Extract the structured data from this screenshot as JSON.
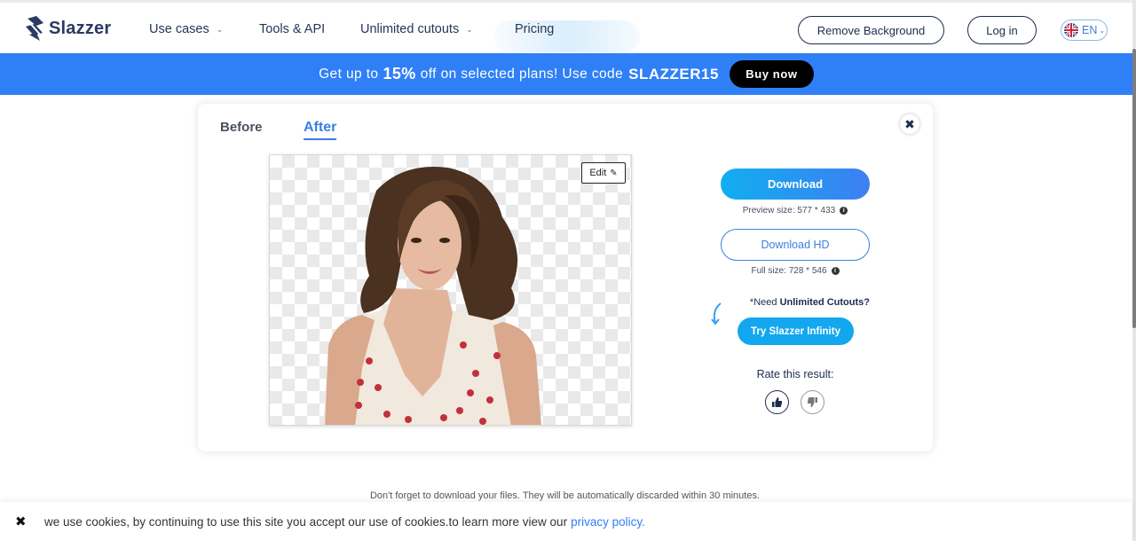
{
  "nav": {
    "brand": "Slazzer",
    "items": [
      {
        "label": "Use cases",
        "has_dropdown": true
      },
      {
        "label": "Tools & API",
        "has_dropdown": false
      },
      {
        "label": "Unlimited cutouts",
        "has_dropdown": true
      },
      {
        "label": "Pricing",
        "has_dropdown": false
      }
    ],
    "remove_bg_label": "Remove Background",
    "login_label": "Log in",
    "language": "EN"
  },
  "promo": {
    "text_prefix": "Get up to",
    "discount": "15%",
    "text_middle": "off on selected plans! Use code",
    "code": "SLAZZER15",
    "button_label": "Buy now"
  },
  "result": {
    "tabs": [
      "Before",
      "After"
    ],
    "active_tab": "After",
    "edit_label": "Edit",
    "download_label": "Download",
    "preview_size": "Preview size: 577 * 433",
    "download_hd_label": "Download HD",
    "full_size": "Full size: 728 * 546",
    "need_prefix": "*Need",
    "need_bold": "Unlimited Cutouts?",
    "try_label": "Try Slazzer Infinity",
    "rate_label": "Rate this result:"
  },
  "discard_note": "Don't forget to download your files. They will be automatically discarded within 30 minutes.",
  "cookie": {
    "text": "we use cookies, by continuing to use this site you accept our use of cookies.to learn more view our",
    "link": "privacy policy."
  },
  "colors": {
    "brand_dark": "#1d2b4f",
    "promo_blue": "#2f7ff7",
    "accent_blue": "#3d7fe0",
    "try_blue": "#12a7ef"
  }
}
